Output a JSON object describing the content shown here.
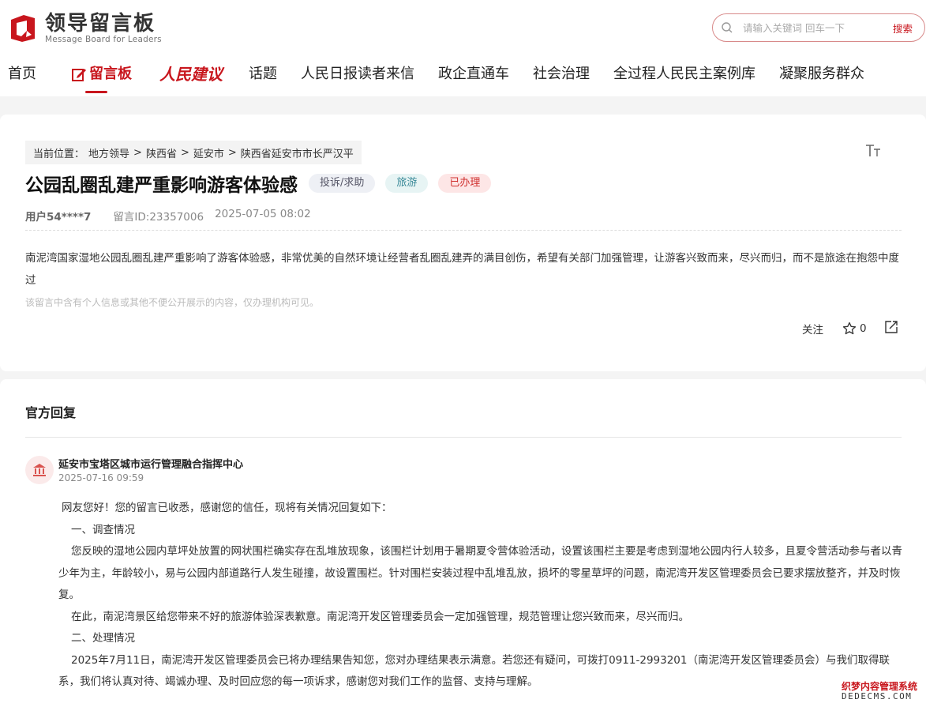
{
  "site": {
    "title": "领导留言板",
    "subtitle": "Message Board for Leaders"
  },
  "search": {
    "placeholder": "请输入关键词 回车一下",
    "button": "搜索"
  },
  "nav": [
    {
      "label": "首页"
    },
    {
      "label": "留言板",
      "active": true
    },
    {
      "label": "人民建议"
    },
    {
      "label": "话题"
    },
    {
      "label": "人民日报读者来信"
    },
    {
      "label": "政企直通车"
    },
    {
      "label": "社会治理"
    },
    {
      "label": "全过程人民民主案例库"
    },
    {
      "label": "凝聚服务群众"
    }
  ],
  "breadcrumb": {
    "prefix": "当前位置：",
    "items": [
      "地方领导",
      "陕西省",
      "延安市",
      "陕西省延安市市长严汉平"
    ],
    "separator": ">"
  },
  "font_toggle": "TT",
  "message": {
    "title": "公园乱圈乱建严重影响游客体验感",
    "tags": [
      "投诉/求助",
      "旅游",
      "已办理"
    ],
    "user": "用户54****7",
    "id": "留言ID:23357006",
    "time": "2025-07-05 08:02",
    "content": "南泥湾国家湿地公园乱圈乱建严重影响了游客体验感，非常优美的自然环境让经营者乱圈乱建弄的满目创伤，希望有关部门加强管理，让游客兴致而来，尽兴而归，而不是旅途在抱怨中度过",
    "privacy_note": "该留言中含有个人信息或其他不便公开展示的内容，仅办理机构可见。",
    "follow": "关注",
    "star_count": "0"
  },
  "reply": {
    "heading": "官方回复",
    "org": "延安市宝塔区城市运行管理融合指挥中心",
    "time": "2025-07-16 09:59",
    "paragraphs": [
      "网友您好！您的留言已收悉，感谢您的信任，现将有关情况回复如下：",
      "一、调查情况",
      "您反映的湿地公园内草坪处放置的网状围栏确实存在乱堆放现象，该围栏计划用于暑期夏令营体验活动，设置该围栏主要是考虑到湿地公园内行人较多，且夏令营活动参与者以青少年为主，年龄较小，易与公园内部道路行人发生碰撞，故设置围栏。针对围栏安装过程中乱堆乱放，损坏的零星草坪的问题，南泥湾开发区管理委员会已要求摆放整齐，并及时恢复。",
      "在此，南泥湾景区给您带来不好的旅游体验深表歉意。南泥湾开发区管理委员会一定加强管理，规范管理让您兴致而来，尽兴而归。",
      "二、处理情况",
      "2025年7月11日，南泥湾开发区管理委员会已将办理结果告知您，您对办理结果表示满意。若您还有疑问，可拨打0911-2993201（南泥湾开发区管理委员会）与我们取得联系，我们将认真对待、竭诚办理、及时回应您的每一项诉求，感谢您对我们工作的监督、支持与理解。"
    ]
  },
  "watermark": {
    "line1": "织梦内容管理系统",
    "line2": "DEDECMS.COM"
  },
  "colors": {
    "accent": "#c8161d",
    "tag_gray_bg": "#eef0f5",
    "tag_teal_bg": "#e7f4f4",
    "tag_red_bg": "#fde6e6"
  }
}
